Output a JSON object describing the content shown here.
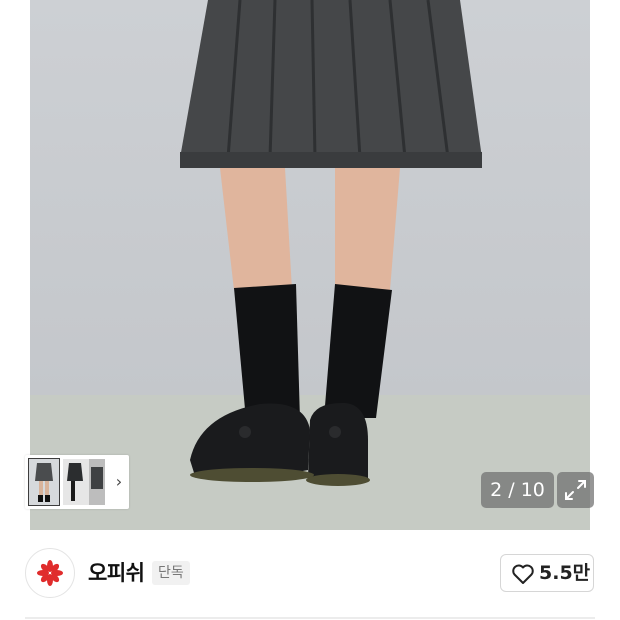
{
  "gallery": {
    "current_page": "2",
    "total_pages": "10",
    "counter_text": "2 / 10",
    "thumbnails": [
      "thumb-skirt-front",
      "thumb-skirt-side",
      "thumb-skirt-detail"
    ],
    "next_icon": "chevron-right-icon",
    "expand_icon": "expand-icon"
  },
  "brand": {
    "name": "오피쉬",
    "tag": "단독",
    "logo_icon": "brand-logo-icon",
    "logo_color": "#e02c2c"
  },
  "like": {
    "icon": "heart-icon",
    "count": "5.5만"
  }
}
